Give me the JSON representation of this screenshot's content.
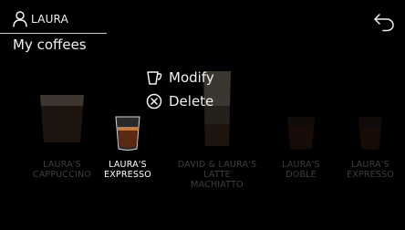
{
  "header": {
    "user_name": "LAURA",
    "title": "My coffees",
    "icons": {
      "user": "user-icon",
      "back": "back-arrow-icon"
    }
  },
  "menu": {
    "items": [
      {
        "label": "Modify",
        "icon": "cup-edit-icon"
      },
      {
        "label": "Delete",
        "icon": "circle-x-icon"
      }
    ]
  },
  "coffees": [
    {
      "name": "LAURA'S\nCAPPUCCINO",
      "selected": false
    },
    {
      "name": "LAURA'S\nEXPRESSO",
      "selected": true
    },
    {
      "name": "DAVID & LAURA'S\nLATTE MACHIATTO",
      "selected": false
    },
    {
      "name": "LAURA'S\nDOBLE",
      "selected": false
    },
    {
      "name": "LAURA'S\nEXPRESSO",
      "selected": false
    }
  ],
  "colors": {
    "background": "#000000",
    "text": "#f2f2f2",
    "coffee": "#5a2a12",
    "crema": "#c67a3a"
  }
}
